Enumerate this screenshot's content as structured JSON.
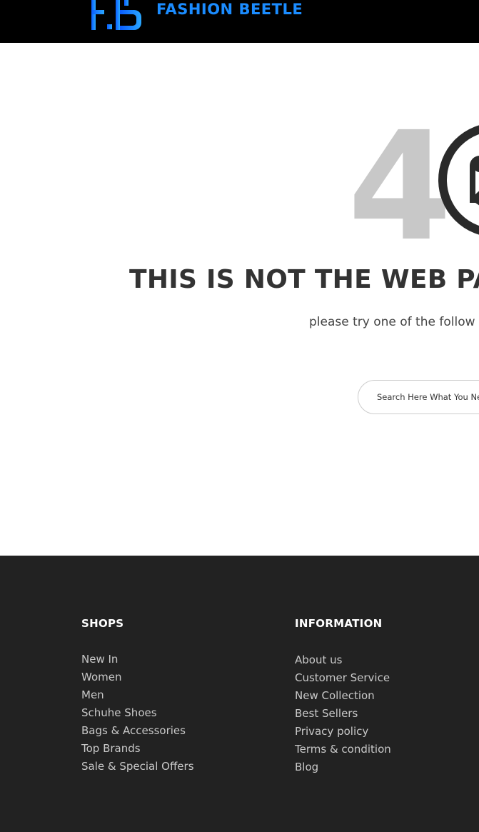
{
  "header": {
    "logo_text": "FASHION BEETLE",
    "logo_mark": "F.B",
    "brand_color": "#1b8cff",
    "background": "#000000"
  },
  "error": {
    "code_visible": "4",
    "face_icon": "sad-face-icon",
    "title": "THIS IS NOT THE WEB PAC",
    "subtitle": "please try one of the follow",
    "search_placeholder": "Search Here What You Need"
  },
  "footer": {
    "shops": {
      "title": "SHOPS",
      "items": [
        "New In",
        "Women",
        "Men",
        "Schuhe Shoes",
        "Bags & Accessories",
        "Top Brands",
        "Sale & Special Offers"
      ]
    },
    "information": {
      "title": "INFORMATION",
      "items": [
        "About us",
        "Customer Service",
        "New Collection",
        "Best Sellers",
        "Privacy policy",
        "Terms & condition",
        "Blog"
      ]
    },
    "background": "#222222"
  }
}
